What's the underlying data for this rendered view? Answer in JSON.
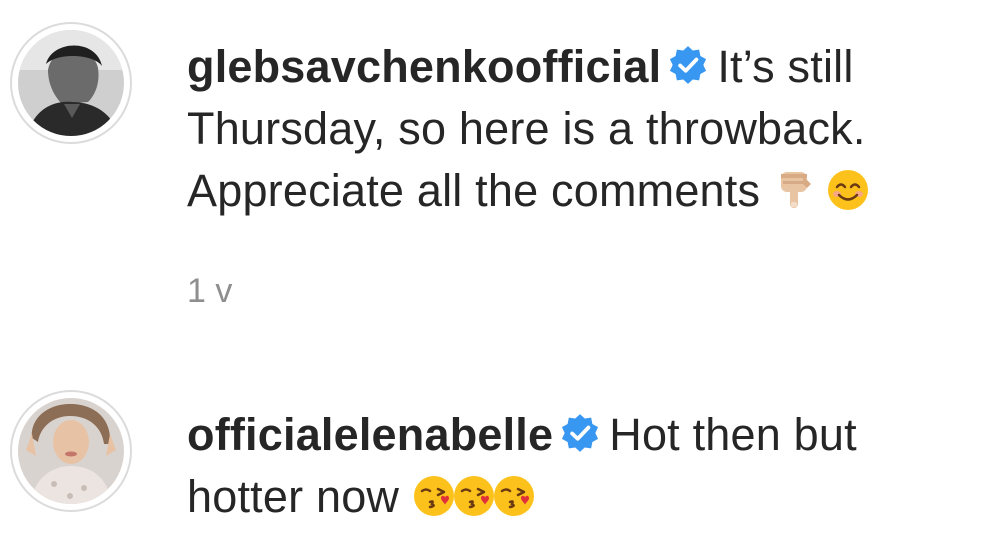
{
  "comments": [
    {
      "username": "glebsavchenkoofficial",
      "verified": true,
      "text": "It’s still Thursday, so here is a throwback. Appreciate all the comments",
      "emojis": [
        "backhand-index-pointing-down",
        "smiling-face-with-smiling-eyes"
      ],
      "timestamp": "1 v"
    },
    {
      "username": "officialelenabelle",
      "verified": true,
      "text": "Hot then but hotter now",
      "emojis": [
        "face-blowing-a-kiss",
        "face-blowing-a-kiss",
        "face-blowing-a-kiss"
      ]
    }
  ],
  "colors": {
    "text": "#262626",
    "muted": "#8e8e8e",
    "verified_badge": "#3897f0",
    "avatar_ring": "#dbdbdb"
  }
}
